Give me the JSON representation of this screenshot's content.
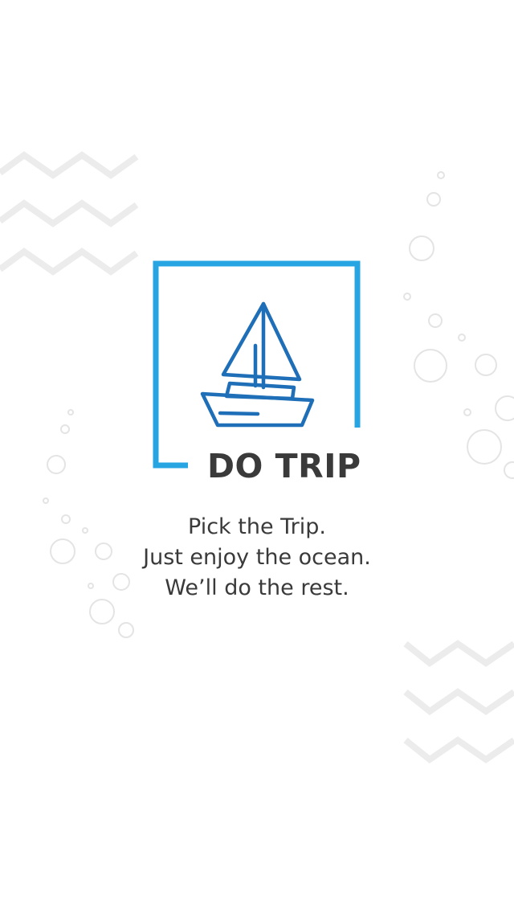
{
  "brand": {
    "name": "DO TRIP",
    "logo_icon": "sailboat-icon",
    "frame_color": "#27a4e2",
    "boat_color": "#1e6fb7",
    "text_color": "#3a3a3a"
  },
  "tagline": {
    "line1": "Pick the Trip.",
    "line2": "Just enjoy the ocean.",
    "line3": "We’ll do the rest."
  },
  "decorations": {
    "top_left": "zigzag-waves-icon",
    "bottom_right": "zigzag-waves-icon",
    "bubbles": "bubbles-icon",
    "wave_color": "#ededed"
  }
}
